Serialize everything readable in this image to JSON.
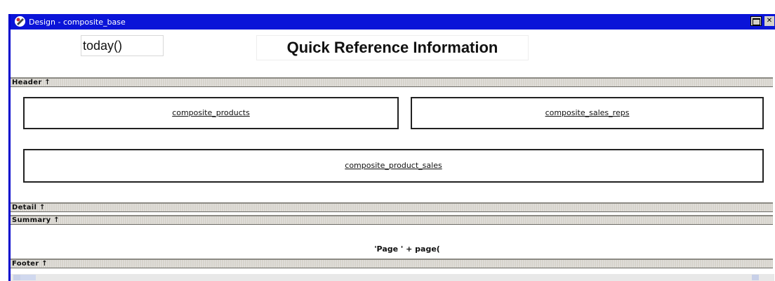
{
  "window": {
    "title": "Design - composite_base"
  },
  "header": {
    "date_expression": "today()",
    "report_title": "Quick Reference Information"
  },
  "bands": {
    "header": "Header ↑",
    "detail": "Detail ↑",
    "summary": "Summary ↑",
    "footer": "Footer ↑"
  },
  "detail": {
    "reports": [
      "composite_products",
      "composite_sales_reps",
      "composite_product_sales"
    ]
  },
  "summary": {
    "page_expression": "'Page ' + page("
  },
  "colors": {
    "titlebar": "#0a14d8",
    "band": "#d6d3cc",
    "window_border": "#0000cc"
  },
  "icons": {
    "window": "app-icon",
    "maximize": "maximize-icon",
    "close": "close-icon"
  }
}
